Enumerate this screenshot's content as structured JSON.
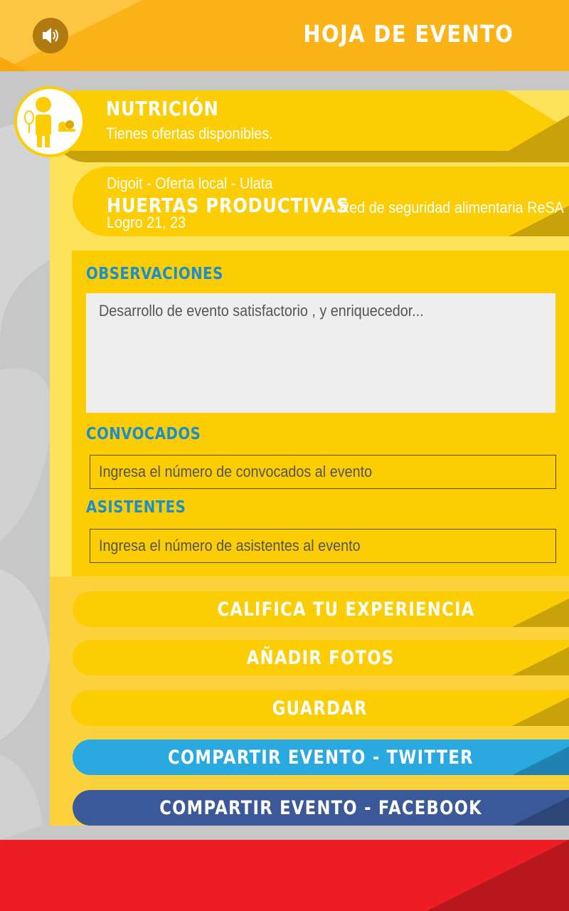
{
  "header": {
    "title": "HOJA DE EVENTO",
    "sound_icon": "speaker-volume-icon"
  },
  "category": {
    "title": "NUTRICIÓN",
    "subtitle": "Tienes  ofertas disponibles.",
    "avatar_icon": "nutrition-person-icon"
  },
  "event": {
    "line1": "Digoit - Oferta local - Ulata",
    "name": "HUERTAS PRODUCTIVAS",
    "network": "Red de seguridad alimentaria ReSA",
    "achievement": "Logro 21, 23"
  },
  "form": {
    "observations_label": "OBSERVACIONES",
    "observations_value": "Desarrollo de evento satisfactorio , y enriquecedor...",
    "summoned_label": "CONVOCADOS",
    "summoned_placeholder": "Ingresa el número de convocados al evento",
    "attendees_label": "ASISTENTES",
    "attendees_placeholder": "Ingresa el número de asistentes al evento"
  },
  "actions": {
    "rate": "CALIFICA TU EXPERIENCIA",
    "add_photos": "AÑADIR FOTOS",
    "save": "GUARDAR",
    "share_twitter": "COMPARTIR EVENTO - TWITTER",
    "share_facebook": "COMPARTIR EVENTO - FACEBOOK"
  },
  "colors": {
    "header": "#fbb318",
    "primary_yellow": "#fccd03",
    "label_blue": "#1b8fcc",
    "twitter": "#29a9e0",
    "facebook": "#3b5998",
    "footer_red": "#ee1c24"
  }
}
